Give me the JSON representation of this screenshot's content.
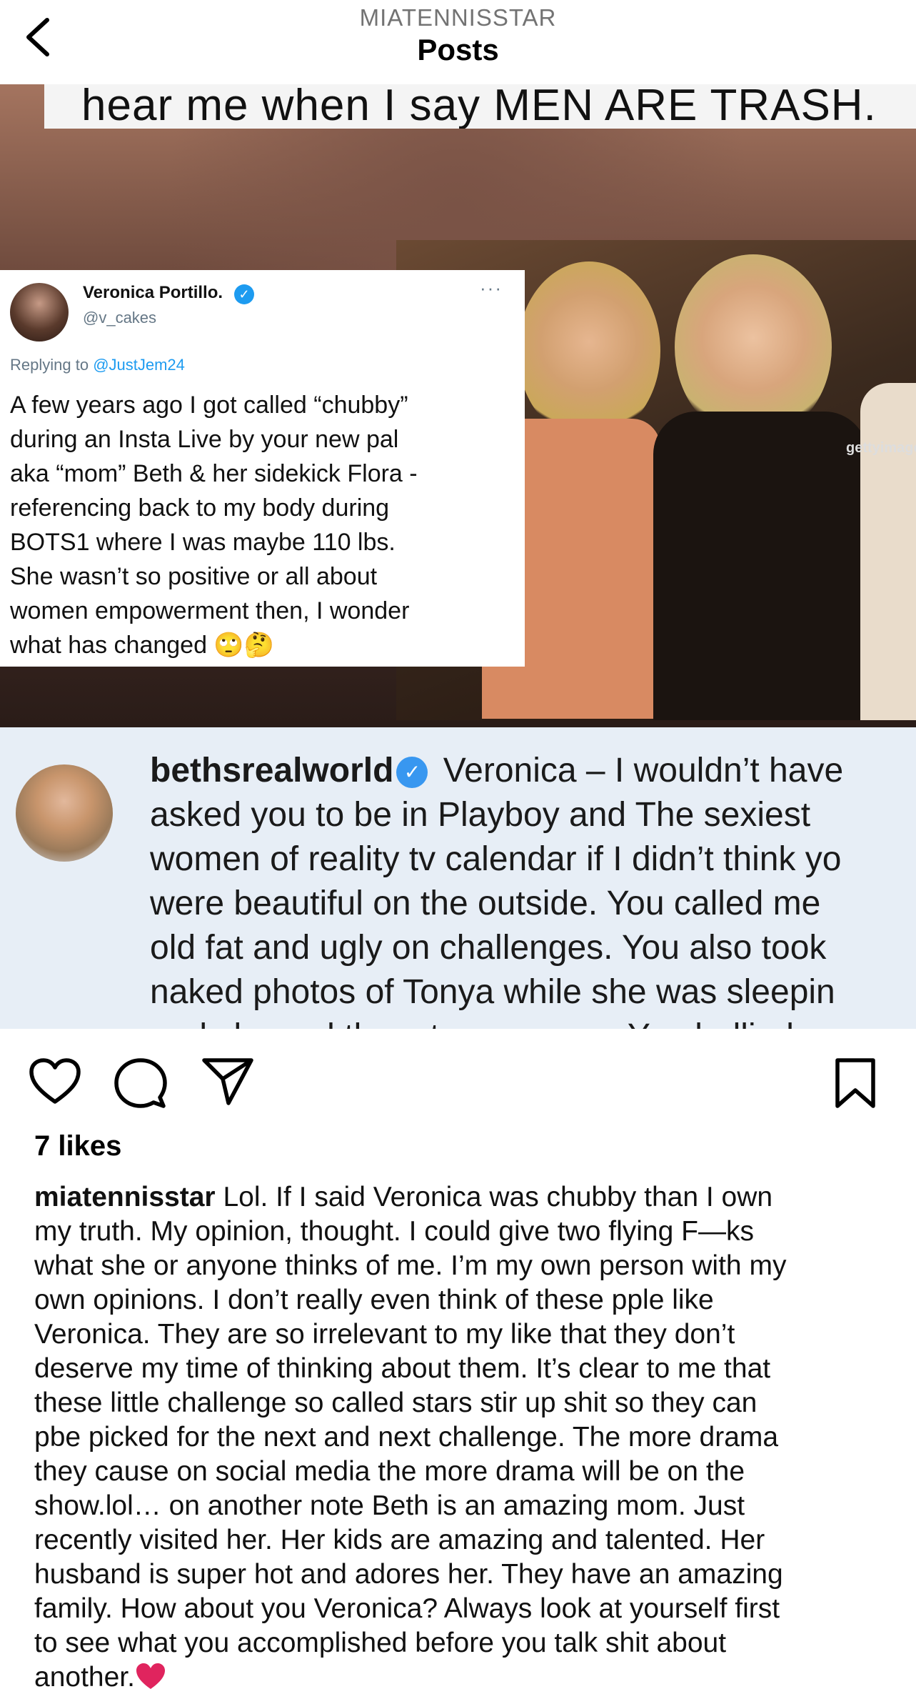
{
  "header": {
    "username": "MIATENNISSTAR",
    "title": "Posts"
  },
  "post_image": {
    "banner_text": "hear me when I say MEN ARE TRASH.",
    "tweet": {
      "name": "Veronica Portillo.",
      "handle": "@v_cakes",
      "more": "···",
      "replying_prefix": "Replying to ",
      "replying_mention": "@JustJem24",
      "body": "A few years ago I got called “chubby”\nduring an Insta Live by your new pal\naka “mom” Beth & her sidekick Flora -\nreferencing back to my body during\nBOTS1 where I was maybe 110 lbs.\nShe wasn’t so positive or all about\nwomen empowerment then, I wonder\nwhat has changed 🙄🤔"
    },
    "photo_watermark": "gettyimages",
    "comment": {
      "username": "bethsrealworld",
      "text_first": "Veronica – I wouldn’t have",
      "text_rest": "asked you to be in Playboy and The sexiest\nwomen of reality tv calendar if I didn’t think yo\nwere beautiful on the outside.  You called me\nold fat and ugly on challenges. You also took\nnaked photos of Tonya while she was sleepin\nand showed them to everyone.  You bullied"
    }
  },
  "actions": {
    "icons": [
      "heart-icon",
      "comment-icon",
      "share-icon",
      "bookmark-icon"
    ]
  },
  "likes": "7 likes",
  "caption": {
    "username": "miatennisstar",
    "text": "Lol. If I said Veronica was chubby than I own\nmy truth. My opinion, thought. I could give two flying F—ks\nwhat she or anyone thinks of me. I’m my own person with my\nown opinions. I don’t really even think of these pple like\nVeronica. They are so irrelevant to my like that they don’t\ndeserve my time of thinking about them. It’s clear to me that\nthese little challenge so called stars stir up shit so they can\npbe picked for the next and next challenge. The more drama\nthey cause on social media the more drama will be on the\nshow.lol… on another note Beth is an amazing mom. Just\nrecently visited her. Her kids are amazing and talented. Her\nhusband is super hot and adores her. They have an amazing\nfamily. How about you Veronica?  Always look at yourself first\nto see what you accomplished before you talk shit about\nanother."
  },
  "colors": {
    "verified_blue": "#3897f0",
    "mention_blue": "#1d9bf0",
    "heart_red": "#e0245e"
  }
}
